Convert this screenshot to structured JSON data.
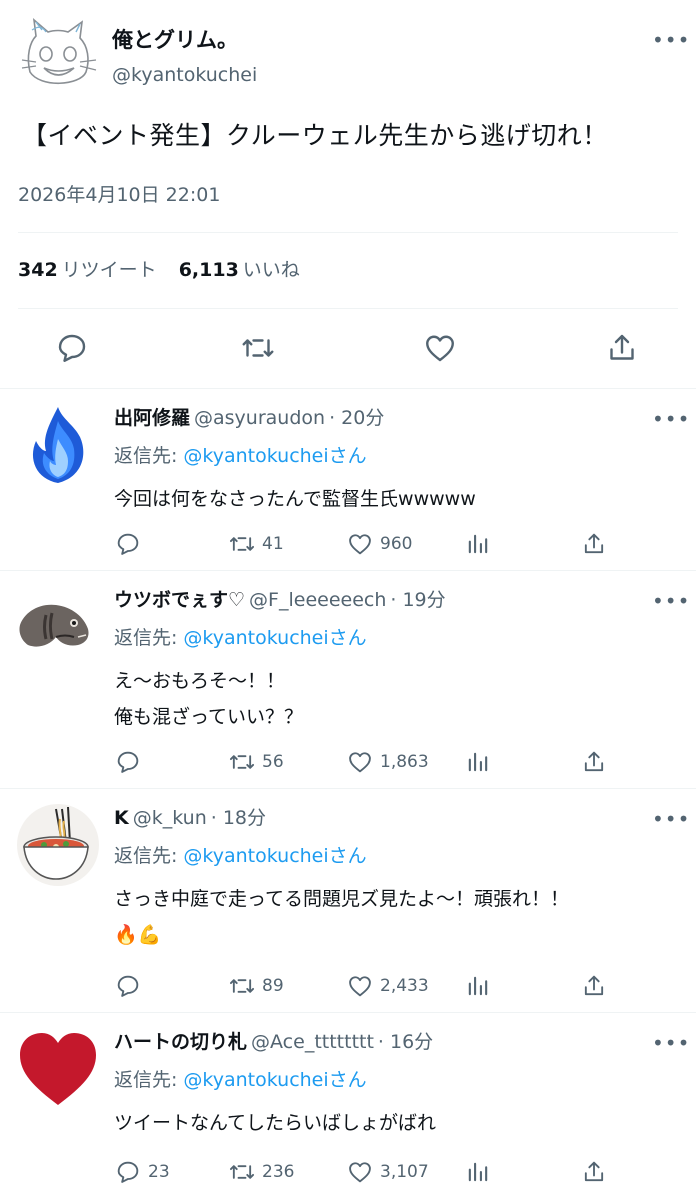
{
  "main_tweet": {
    "author_name": "俺とグリム。",
    "author_handle": "@kyantokuchei",
    "text": "【イベント発生】クルーウェル先生から逃げ切れ！",
    "timestamp": "2026年4月10日 22:01",
    "retweet_count": "342",
    "retweet_label": "リツイート",
    "like_count": "6,113",
    "like_label": "いいね",
    "more_label": "•••"
  },
  "replies": [
    {
      "name": "出阿修羅",
      "handle": "@asyuraudon",
      "time": "· 20分",
      "reply_to_label": "返信先:",
      "reply_to_link": "@kyantokucheiさん",
      "lines": [
        "今回は何をなさったんで監督生氏wwwww"
      ],
      "reply_count": "",
      "retweet_count": "41",
      "like_count": "960",
      "avatar": "blue-flame-icon"
    },
    {
      "name": "ウツボでぇす♡",
      "handle": "@F_leeeeeech",
      "time": "· 19分",
      "reply_to_label": "返信先:",
      "reply_to_link": "@kyantokucheiさん",
      "lines": [
        "え〜おもろそ〜！！",
        "俺も混ざっていい？？"
      ],
      "reply_count": "",
      "retweet_count": "56",
      "like_count": "1,863",
      "avatar": "moray-eel-icon"
    },
    {
      "name": "K",
      "handle": "@k_kun",
      "time": "· 18分",
      "reply_to_label": "返信先:",
      "reply_to_link": "@kyantokucheiさん",
      "lines": [
        "さっき中庭で走ってる問題児ズ見たよ〜！頑張れ！！",
        "🔥💪"
      ],
      "reply_count": "",
      "retweet_count": "89",
      "like_count": "2,433",
      "avatar": "noodle-bowl-icon"
    },
    {
      "name": "ハートの切り札",
      "handle": "@Ace_tttttttt",
      "time": "· 16分",
      "reply_to_label": "返信先:",
      "reply_to_link": "@kyantokucheiさん",
      "lines": [
        "ツイートなんてしたらいばしょがばれ"
      ],
      "reply_count": "23",
      "retweet_count": "236",
      "like_count": "3,107",
      "avatar": "red-heart-icon"
    }
  ],
  "colors": {
    "text": "#0f1419",
    "secondary": "#536471",
    "link": "#1d9bf0",
    "divider": "#eff3f4"
  }
}
